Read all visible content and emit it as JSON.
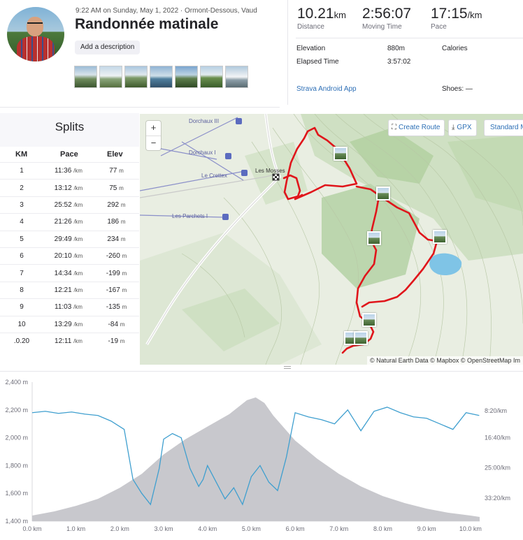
{
  "header": {
    "datetime": "9:22 AM on Sunday, May 1, 2022",
    "location": "Ormont-Dessous, Vaud",
    "title": "Randonnée matinale",
    "add_description": "Add a description",
    "photo_count": 7
  },
  "stats": {
    "distance": {
      "value": "10.21",
      "unit": "km",
      "label": "Distance"
    },
    "moving_time": {
      "value": "2:56:07",
      "label": "Moving Time"
    },
    "pace": {
      "value": "17:15",
      "unit": "/km",
      "label": "Pace"
    },
    "elevation_label": "Elevation",
    "elevation_value": "880m",
    "calories_label": "Calories",
    "elapsed_label": "Elapsed Time",
    "elapsed_value": "3:57:02",
    "device": "Strava Android App",
    "shoes_label": "Shoes: —"
  },
  "splits": {
    "title": "Splits",
    "headers": {
      "km": "KM",
      "pace": "Pace",
      "elev": "Elev"
    },
    "pace_unit": "/km",
    "elev_unit": "m",
    "rows": [
      {
        "km": "1",
        "pace": "11:36",
        "elev": "77"
      },
      {
        "km": "2",
        "pace": "13:12",
        "elev": "75"
      },
      {
        "km": "3",
        "pace": "25:52",
        "elev": "292"
      },
      {
        "km": "4",
        "pace": "21:26",
        "elev": "186"
      },
      {
        "km": "5",
        "pace": "29:49",
        "elev": "234"
      },
      {
        "km": "6",
        "pace": "20:10",
        "elev": "-260"
      },
      {
        "km": "7",
        "pace": "14:34",
        "elev": "-199"
      },
      {
        "km": "8",
        "pace": "12:21",
        "elev": "-167"
      },
      {
        "km": "9",
        "pace": "11:03",
        "elev": "-135"
      },
      {
        "km": "10",
        "pace": "13:29",
        "elev": "-84"
      },
      {
        "km": ".0.20",
        "pace": "12:11",
        "elev": "-19"
      }
    ]
  },
  "map": {
    "zoom_in": "+",
    "zoom_out": "−",
    "create_route": "Create Route",
    "gpx": "GPX",
    "standard_map": "Standard M",
    "attribution": "© Natural Earth Data © Mapbox © OpenStreetMap Im",
    "labels": {
      "dorchaux_iii": "Dorchaux III",
      "dorchaux_i": "Dorchaux I",
      "le_crettex": "Le Crettex",
      "les_parchets": "Les Parchets I",
      "les_mosses": "Les Mosses"
    },
    "route_color": "#e0151b"
  },
  "chart_data": {
    "type": "area",
    "x_ticks": [
      "0.0 km",
      "1.0 km",
      "2.0 km",
      "3.0 km",
      "4.0 km",
      "5.0 km",
      "6.0 km",
      "7.0 km",
      "8.0 km",
      "9.0 km",
      "10.0 km"
    ],
    "y_ticks": [
      "2,400 m",
      "2,200 m",
      "2,000 m",
      "1,800 m",
      "1,600 m",
      "1,400 m"
    ],
    "y2_ticks": [
      "8:20/km",
      "16:40/km",
      "25:00/km",
      "33:20/km"
    ],
    "ylim": [
      1400,
      2400
    ],
    "xlim": [
      0,
      10.21
    ],
    "series": [
      {
        "kind": "elevation",
        "color": "#c8c8cd",
        "x": [
          0,
          0.5,
          1.0,
          1.5,
          2.0,
          2.5,
          3.0,
          3.5,
          4.0,
          4.5,
          4.9,
          5.1,
          5.3,
          5.5,
          6.0,
          6.5,
          7.0,
          7.5,
          8.0,
          8.5,
          9.0,
          9.5,
          10.0,
          10.21
        ],
        "values": [
          1440,
          1470,
          1510,
          1560,
          1640,
          1740,
          1880,
          1990,
          2080,
          2170,
          2270,
          2290,
          2250,
          2160,
          1980,
          1850,
          1740,
          1650,
          1580,
          1530,
          1490,
          1460,
          1440,
          1430
        ]
      },
      {
        "kind": "pace",
        "color": "#3f9fcf",
        "x": [
          0,
          0.3,
          0.6,
          0.9,
          1.2,
          1.5,
          1.8,
          2.1,
          2.3,
          2.5,
          2.7,
          2.9,
          3.0,
          3.2,
          3.4,
          3.6,
          3.8,
          3.9,
          4.0,
          4.2,
          4.4,
          4.6,
          4.8,
          5.0,
          5.2,
          5.4,
          5.6,
          5.8,
          6.0,
          6.3,
          6.6,
          6.9,
          7.2,
          7.5,
          7.8,
          8.1,
          8.4,
          8.7,
          9.0,
          9.3,
          9.6,
          9.9,
          10.2
        ],
        "values": [
          2180,
          2190,
          2175,
          2185,
          2170,
          2160,
          2120,
          2060,
          1700,
          1600,
          1520,
          1780,
          1990,
          2030,
          2000,
          1780,
          1650,
          1700,
          1800,
          1680,
          1560,
          1640,
          1520,
          1720,
          1800,
          1680,
          1620,
          1860,
          2180,
          2150,
          2130,
          2100,
          2200,
          2050,
          2190,
          2220,
          2180,
          2150,
          2140,
          2100,
          2060,
          2180,
          2160
        ]
      }
    ]
  }
}
